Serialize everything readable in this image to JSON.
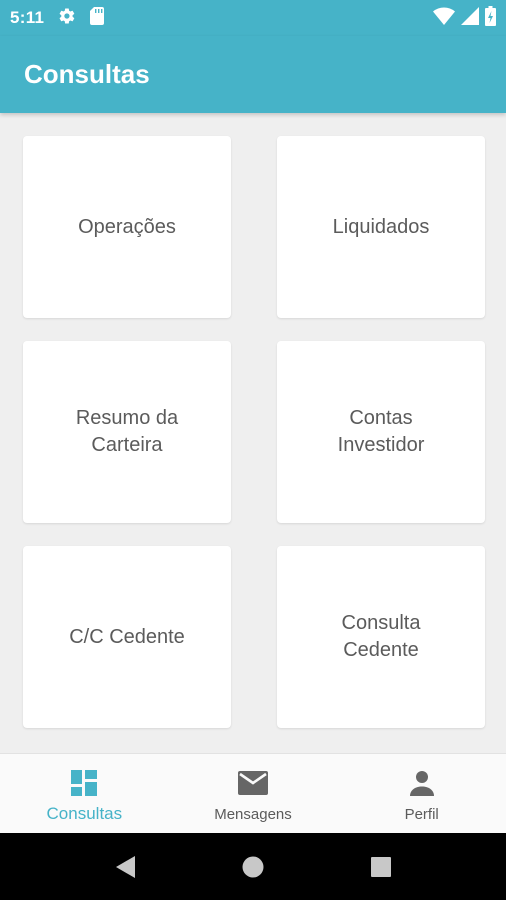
{
  "status_bar": {
    "time": "5:11",
    "icons": [
      "gear-icon",
      "sd-card-icon",
      "wifi-icon",
      "cell-signal-icon",
      "battery-icon"
    ]
  },
  "app_bar": {
    "title": "Consultas"
  },
  "cards": [
    {
      "label": "Operações"
    },
    {
      "label": "Liquidados"
    },
    {
      "label": "Resumo da\nCarteira"
    },
    {
      "label": "Contas\nInvestidor"
    },
    {
      "label": "C/C Cedente"
    },
    {
      "label": "Consulta\nCedente"
    }
  ],
  "bottom_nav": {
    "items": [
      {
        "label": "Consultas",
        "icon": "dashboard-icon",
        "active": true
      },
      {
        "label": "Mensagens",
        "icon": "mail-icon",
        "active": false
      },
      {
        "label": "Perfil",
        "icon": "person-icon",
        "active": false
      }
    ]
  },
  "system_nav": {
    "buttons": [
      "back-icon",
      "home-icon",
      "recents-icon"
    ]
  },
  "colors": {
    "primary": "#46b3c8",
    "background": "#efefef",
    "text": "#5b5b5b",
    "inactive_icon": "#666666"
  }
}
